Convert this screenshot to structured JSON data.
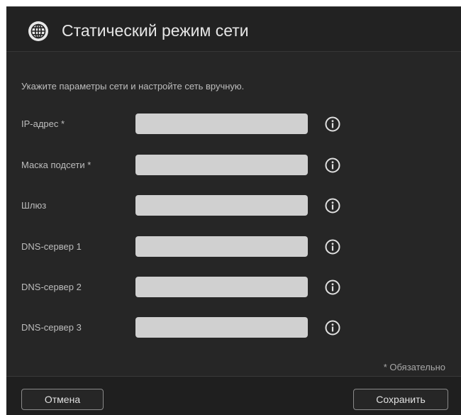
{
  "dialog": {
    "title": "Статический режим сети",
    "intro": "Укажите параметры сети и настройте сеть вручную.",
    "header_icon": "globe-icon",
    "fields": [
      {
        "label": "IP-адрес *",
        "value": "",
        "info_icon": "info-icon"
      },
      {
        "label": "Маска подсети *",
        "value": "",
        "info_icon": "info-icon"
      },
      {
        "label": "Шлюз",
        "value": "",
        "info_icon": "info-icon"
      },
      {
        "label": "DNS-сервер 1",
        "value": "",
        "info_icon": "info-icon"
      },
      {
        "label": "DNS-сервер 2",
        "value": "",
        "info_icon": "info-icon"
      },
      {
        "label": "DNS-сервер 3",
        "value": "",
        "info_icon": "info-icon"
      }
    ],
    "required_note": "* Обязательно"
  },
  "footer": {
    "cancel_label": "Отмена",
    "save_label": "Сохранить"
  },
  "colors": {
    "dialog_bg": "#262626",
    "input_bg": "#d0d0d0",
    "text": "#bdbdbd"
  }
}
